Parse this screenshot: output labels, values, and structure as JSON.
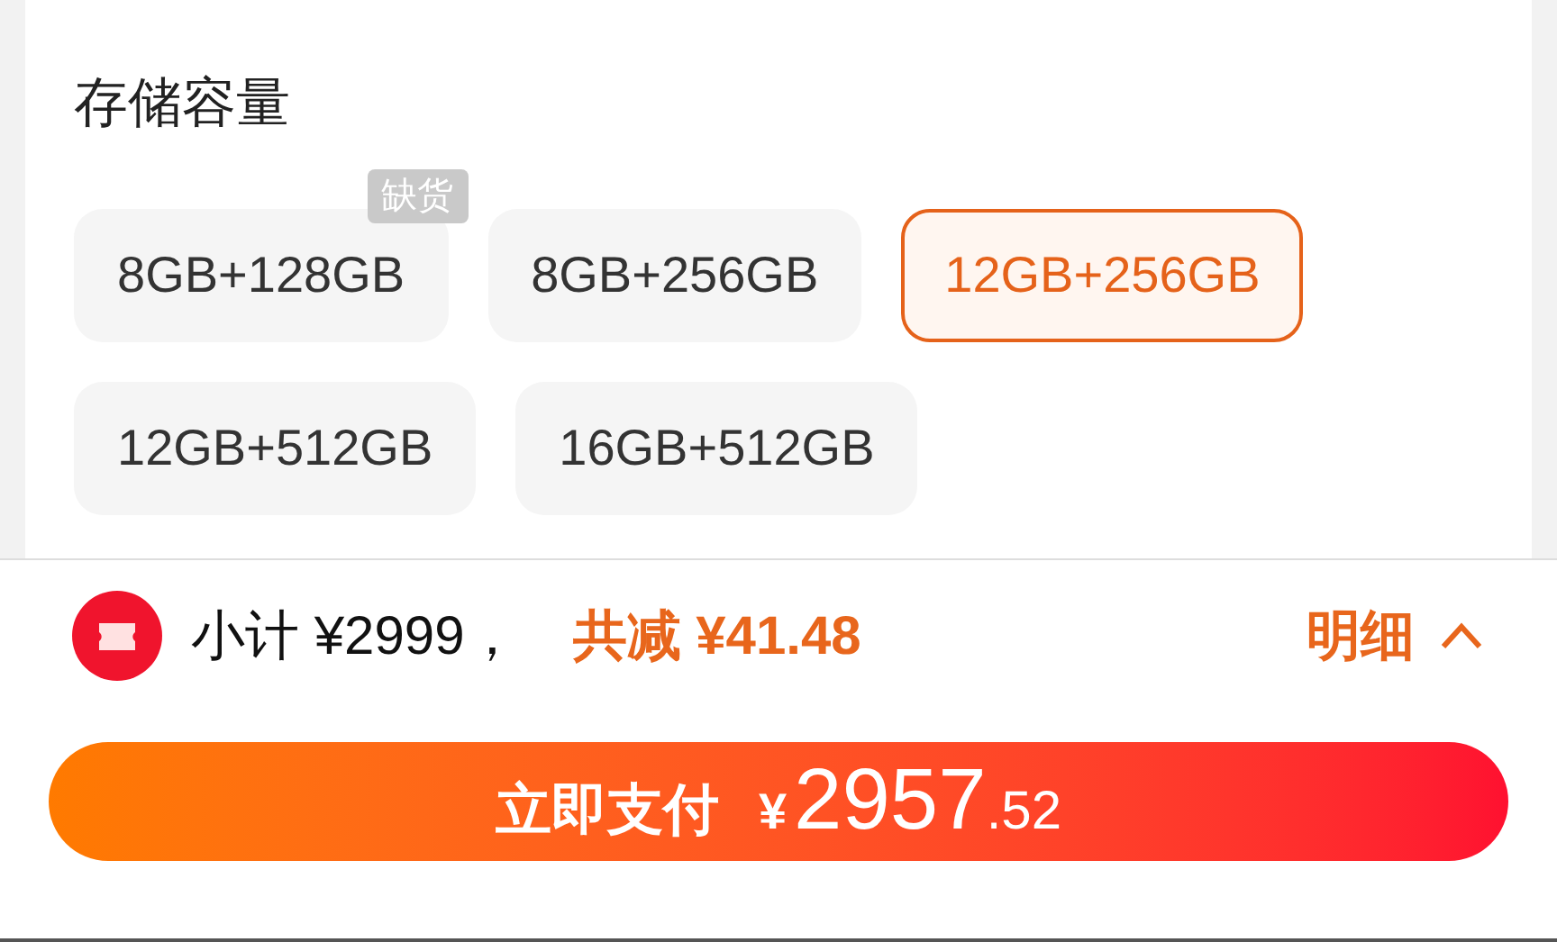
{
  "section": {
    "title": "存储容量",
    "options": [
      {
        "label": "8GB+128GB",
        "selected": false,
        "badge": "缺货"
      },
      {
        "label": "8GB+256GB",
        "selected": false
      },
      {
        "label": "12GB+256GB",
        "selected": true
      },
      {
        "label": "12GB+512GB",
        "selected": false
      },
      {
        "label": "16GB+512GB",
        "selected": false
      }
    ]
  },
  "summary": {
    "subtotal": "小计 ¥2999，",
    "discount": "共减 ¥41.48",
    "details": "明细"
  },
  "pay_button": {
    "label": "立即支付",
    "currency": "¥",
    "integer": "2957",
    "decimal": ".52"
  }
}
